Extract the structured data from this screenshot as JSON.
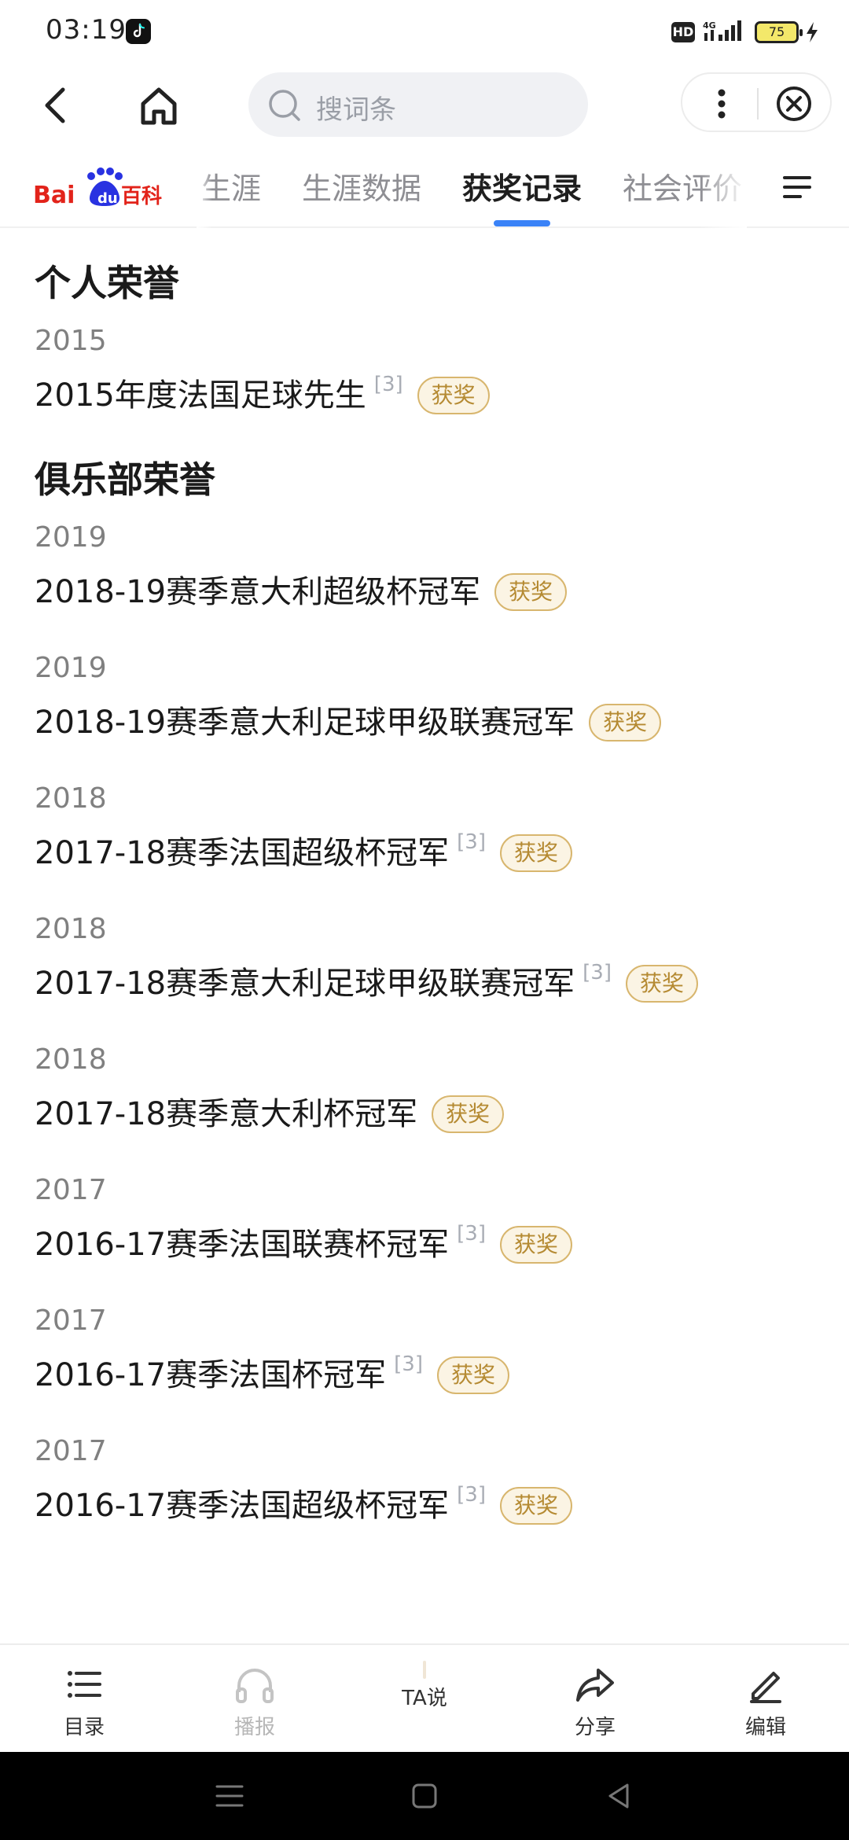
{
  "status_bar": {
    "time": "03:19",
    "network": "4G",
    "battery": "75",
    "hd_label": "HD"
  },
  "toolbar": {
    "search_placeholder": "搜词条"
  },
  "brand": {
    "logo_text": "Bai百科",
    "colors": {
      "red": "#e2231a",
      "blue": "#2932e1"
    }
  },
  "tabs": [
    {
      "label": "生涯"
    },
    {
      "label": "生涯数据"
    },
    {
      "label": "获奖记录",
      "active": true
    },
    {
      "label": "社会评价"
    }
  ],
  "sections": [
    {
      "title": "个人荣誉",
      "awards": [
        {
          "year": "2015",
          "title": "2015年度法国足球先生",
          "ref": "[3]",
          "badge": "获奖"
        }
      ]
    },
    {
      "title": "俱乐部荣誉",
      "awards": [
        {
          "year": "2019",
          "title": "2018-19赛季意大利超级杯冠军",
          "ref": "",
          "badge": "获奖"
        },
        {
          "year": "2019",
          "title": "2018-19赛季意大利足球甲级联赛冠军",
          "ref": "",
          "badge": "获奖"
        },
        {
          "year": "2018",
          "title": "2017-18赛季法国超级杯冠军",
          "ref": "[3]",
          "badge": "获奖"
        },
        {
          "year": "2018",
          "title": "2017-18赛季意大利足球甲级联赛冠军",
          "ref": "[3]",
          "badge": "获奖"
        },
        {
          "year": "2018",
          "title": "2017-18赛季意大利杯冠军",
          "ref": "",
          "badge": "获奖"
        },
        {
          "year": "2017",
          "title": "2016-17赛季法国联赛杯冠军",
          "ref": "[3]",
          "badge": "获奖"
        },
        {
          "year": "2017",
          "title": "2016-17赛季法国杯冠军",
          "ref": "[3]",
          "badge": "获奖"
        },
        {
          "year": "2017",
          "title": "2016-17赛季法国超级杯冠军",
          "ref": "[3]",
          "badge": "获奖"
        }
      ]
    }
  ],
  "bottom_nav": [
    {
      "label": "目录",
      "icon": "list-icon"
    },
    {
      "label": "播报",
      "icon": "headphones-icon",
      "disabled": true
    },
    {
      "label": "TA说",
      "icon": "avatar"
    },
    {
      "label": "分享",
      "icon": "share-icon"
    },
    {
      "label": "编辑",
      "icon": "edit-icon"
    }
  ],
  "accent_color": "#3a82f7",
  "badge_color": "#d8b66e"
}
